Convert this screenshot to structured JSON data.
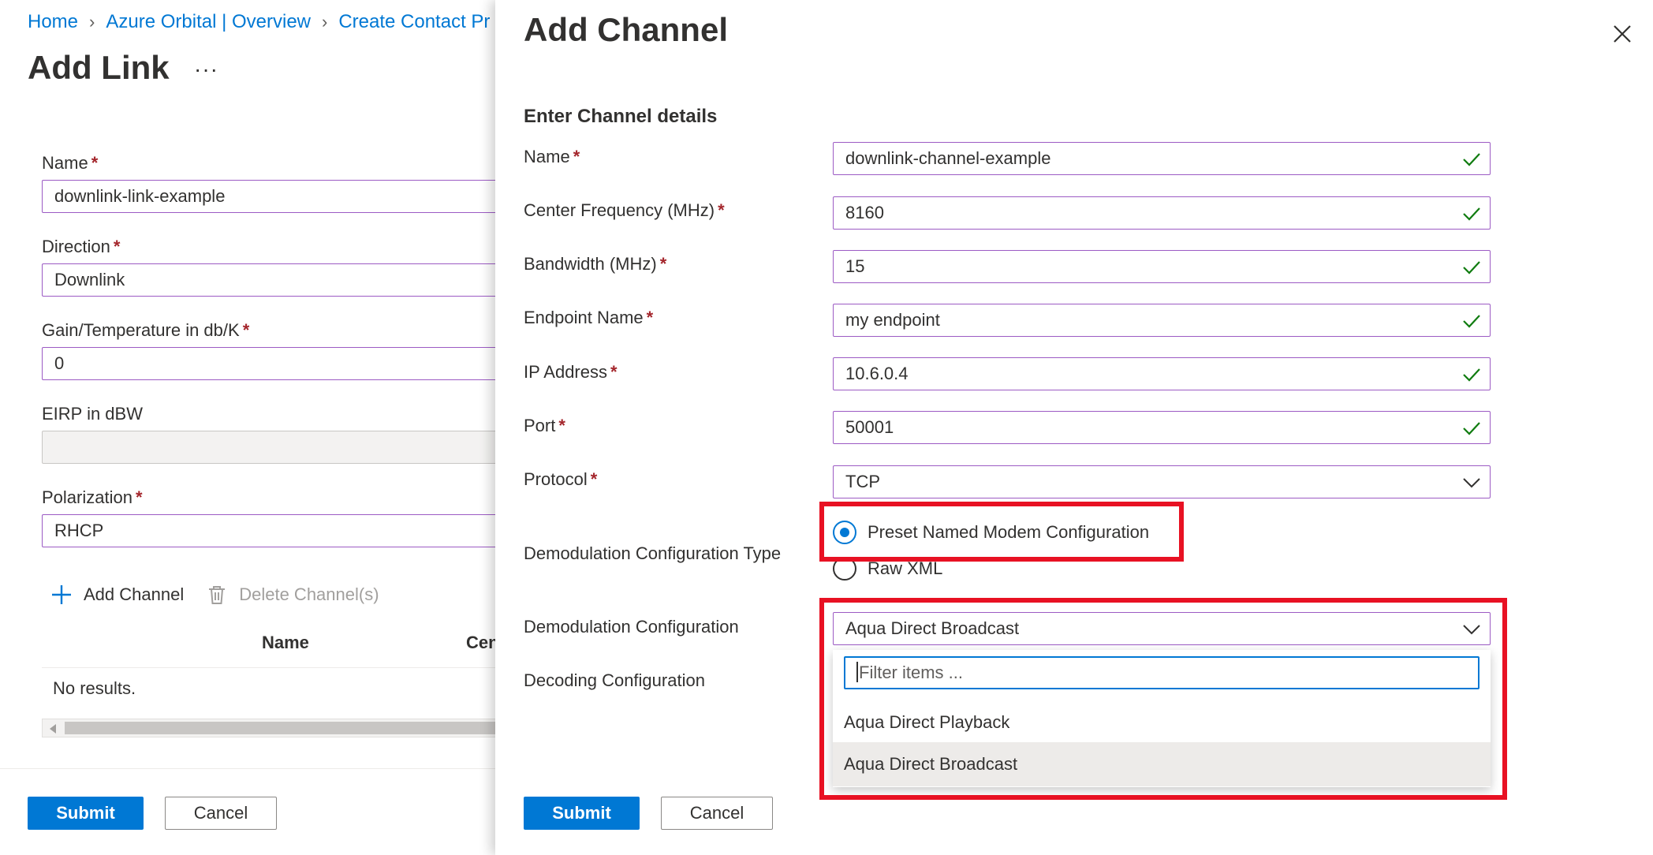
{
  "background": {
    "breadcrumb": [
      "Home",
      "Azure Orbital | Overview",
      "Create Contact Pr"
    ],
    "title": "Add Link",
    "more_label": "···",
    "fields": {
      "name": {
        "label": "Name",
        "value": "downlink-link-example"
      },
      "direction": {
        "label": "Direction",
        "value": "Downlink"
      },
      "gain": {
        "label": "Gain/Temperature in db/K",
        "value": "0"
      },
      "eirp": {
        "label": "EIRP in dBW",
        "value": ""
      },
      "polarization": {
        "label": "Polarization",
        "value": "RHCP"
      }
    },
    "toolbar": {
      "add": "Add Channel",
      "delete": "Delete Channel(s)"
    },
    "table": {
      "columns": [
        "Name",
        "Cen"
      ],
      "empty": "No results."
    },
    "submit": "Submit",
    "cancel": "Cancel"
  },
  "panel": {
    "title": "Add Channel",
    "section": "Enter Channel details",
    "fields": {
      "name": {
        "label": "Name",
        "value": "downlink-channel-example"
      },
      "center_frequency": {
        "label": "Center Frequency (MHz)",
        "value": "8160"
      },
      "bandwidth": {
        "label": "Bandwidth (MHz)",
        "value": "15"
      },
      "endpoint": {
        "label": "Endpoint Name",
        "value": "my endpoint"
      },
      "ip": {
        "label": "IP Address",
        "value": "10.6.0.4"
      },
      "port": {
        "label": "Port",
        "value": "50001"
      },
      "protocol": {
        "label": "Protocol",
        "value": "TCP"
      }
    },
    "demod_type": {
      "label": "Demodulation Configuration Type",
      "options": [
        "Preset Named Modem Configuration",
        "Raw XML"
      ],
      "selected": "Preset Named Modem Configuration"
    },
    "demod_config": {
      "label": "Demodulation Configuration",
      "value": "Aqua Direct Broadcast",
      "filter_placeholder": "Filter items ...",
      "options": [
        "Aqua Direct Playback",
        "Aqua Direct Broadcast"
      ],
      "selected": "Aqua Direct Broadcast"
    },
    "decoding_label": "Decoding Configuration",
    "submit": "Submit",
    "cancel": "Cancel"
  },
  "colors": {
    "accent": "#0078d4",
    "required": "#a4262c",
    "valid_check": "#107c10",
    "highlight": "#e81123",
    "input_border": "#9c5bc4"
  }
}
